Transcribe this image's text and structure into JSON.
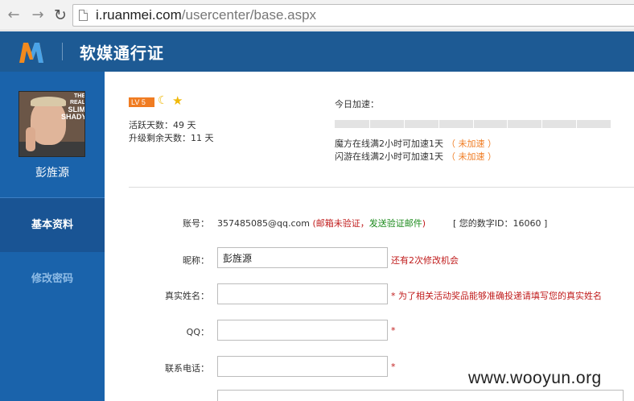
{
  "browser": {
    "back_icon": "back-arrow-icon",
    "forward_icon": "forward-arrow-icon",
    "reload_icon": "reload-icon",
    "url_host": "i.ruanmei.com",
    "url_path": "/usercenter/base.aspx"
  },
  "header": {
    "logo_icon": "ruanmei-logo",
    "title": "软媒通行证",
    "bg_color": "#1d5a94"
  },
  "sidebar": {
    "username": "彭旌源",
    "avatar_text_small": "THE REAL",
    "avatar_text_big": "SLIM",
    "avatar_text_small2": "SHADY",
    "menu": [
      {
        "label": "基本资料",
        "active": true
      },
      {
        "label": "修改密码",
        "active": false
      }
    ],
    "bg_color": "#1a63ab"
  },
  "profile": {
    "level_badge": "LV 5",
    "active_days": "活跃天数：49 天",
    "upgrade_days": "升级剩余天数：11 天"
  },
  "speedup": {
    "label": "今日加速：",
    "progress_fraction": 0,
    "tick_count": 8,
    "lines": [
      {
        "text": "魔方在线满2小时可加速1天",
        "status": "（ 未加速 ）"
      },
      {
        "text": "闪游在线满2小时可加速1天",
        "status": "（ 未加速 ）"
      }
    ]
  },
  "form": {
    "account": {
      "label": "账号：",
      "value": "357485085@qq.com",
      "verify_open": " (",
      "verify_msg": "邮箱未验证，",
      "verify_link": "发送验证邮件",
      "verify_close": ")",
      "numeric_id": "[ 您的数字ID：16060 ]"
    },
    "nickname": {
      "label": "昵称：",
      "value": "彭旌源",
      "hint": "还有2次修改机会"
    },
    "realname": {
      "label": "真实姓名：",
      "value": "",
      "hint": "* 为了相关活动奖品能够准确投递请填写您的真实姓名"
    },
    "qq": {
      "label": "QQ：",
      "value": "",
      "hint": "*"
    },
    "phone": {
      "label": "联系电话：",
      "value": "",
      "hint": "*"
    }
  },
  "watermark": "www.wooyun.org"
}
